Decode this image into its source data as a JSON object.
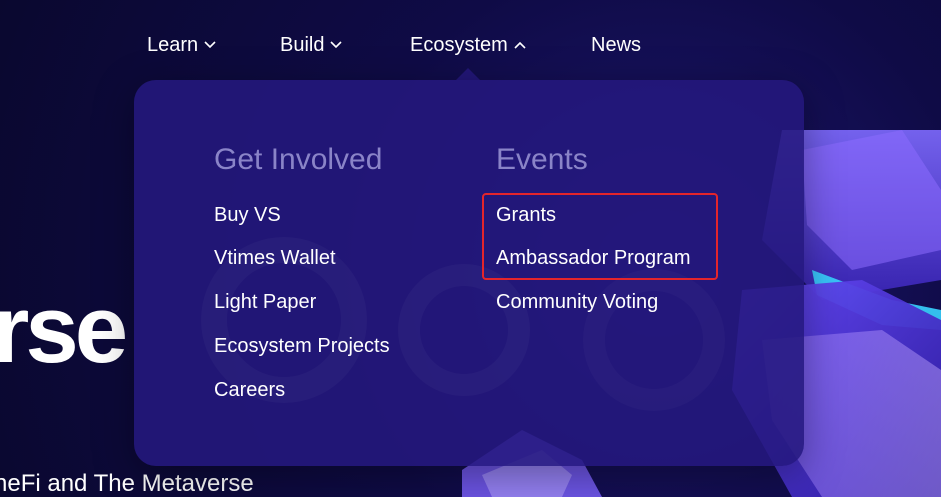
{
  "hero": {
    "headline_fragment": "rse",
    "subline_fragment": "neFi and The Metaverse"
  },
  "nav": {
    "items": [
      {
        "label": "Learn",
        "icon": "chevron-down-icon"
      },
      {
        "label": "Build",
        "icon": "chevron-down-icon"
      },
      {
        "label": "Ecosystem",
        "icon": "chevron-up-icon"
      },
      {
        "label": "News"
      }
    ]
  },
  "dropdown": {
    "columns": [
      {
        "title": "Get Involved",
        "links": [
          "Buy VS",
          "Vtimes Wallet",
          "Light Paper",
          "Ecosystem Projects",
          "Careers"
        ]
      },
      {
        "title": "Events",
        "links": [
          "Grants",
          "Ambassador Program",
          "Community Voting"
        ]
      }
    ]
  },
  "colors": {
    "background": "#0d0a3a",
    "dropdown": "#24187d",
    "column_title": "#8a84c8",
    "text": "#ffffff",
    "highlight": "#e4252b"
  }
}
